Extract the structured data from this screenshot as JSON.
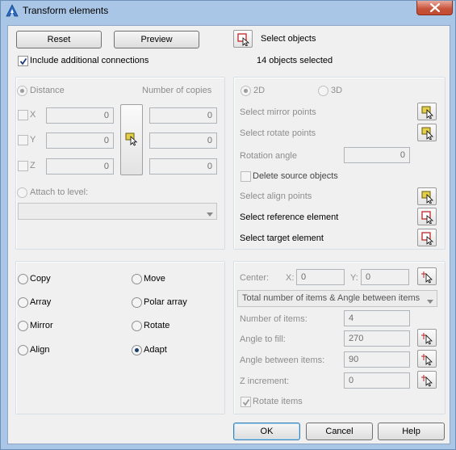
{
  "window": {
    "title": "Transform elements"
  },
  "toolbar": {
    "reset_label": "Reset",
    "preview_label": "Preview",
    "select_objects_label": "Select objects",
    "objects_selected": "14 objects selected",
    "include_connections_label": "Include additional connections",
    "include_connections_checked": true
  },
  "copies_panel": {
    "distance_label": "Distance",
    "number_of_copies_label": "Number of copies",
    "x_label": "X",
    "y_label": "Y",
    "z_label": "Z",
    "x_value": "0",
    "y_value": "0",
    "z_value": "0",
    "x_copies": "0",
    "y_copies": "0",
    "z_copies": "0",
    "attach_to_level_label": "Attach to level:",
    "attach_to_level_value": ""
  },
  "mode_panel": {
    "mode_2d_label": "2D",
    "mode_3d_label": "3D",
    "select_mirror_points_label": "Select mirror points",
    "select_rotate_points_label": "Select rotate points",
    "rotation_angle_label": "Rotation angle",
    "rotation_angle_value": "0",
    "delete_source_label": "Delete source objects",
    "select_align_points_label": "Select align points",
    "select_reference_label": "Select reference element",
    "select_target_label": "Select target element"
  },
  "operations": {
    "copy_label": "Copy",
    "move_label": "Move",
    "array_label": "Array",
    "polar_array_label": "Polar array",
    "mirror_label": "Mirror",
    "rotate_label": "Rotate",
    "align_label": "Align",
    "adapt_label": "Adapt",
    "selected": "Adapt"
  },
  "polar_panel": {
    "center_label": "Center:",
    "center_x_label": "X:",
    "center_y_label": "Y:",
    "center_x_value": "0",
    "center_y_value": "0",
    "method_value": "Total number of items & Angle between items",
    "number_of_items_label": "Number of items:",
    "number_of_items_value": "4",
    "angle_to_fill_label": "Angle to fill:",
    "angle_to_fill_value": "270",
    "angle_between_label": "Angle between items:",
    "angle_between_value": "90",
    "z_increment_label": "Z increment:",
    "z_increment_value": "0",
    "rotate_items_label": "Rotate items",
    "rotate_items_checked": true
  },
  "footer": {
    "ok_label": "OK",
    "cancel_label": "Cancel",
    "help_label": "Help"
  },
  "colors": {
    "frame": "#aac6e6",
    "client": "#f0f0f0",
    "close_button": "#c7523a",
    "pick_arrow_fill": "#e2d04a",
    "pick_red_fill": "#cc3a3a"
  },
  "icons": {
    "app": "app-logo-icon",
    "close": "close-icon",
    "select_objects": "select-objects-icon",
    "pick_yellow": "pick-point-icon",
    "pick_red": "pick-element-icon",
    "pick_cursor": "pick-cursor-icon",
    "dropdown": "chevron-down-icon"
  }
}
